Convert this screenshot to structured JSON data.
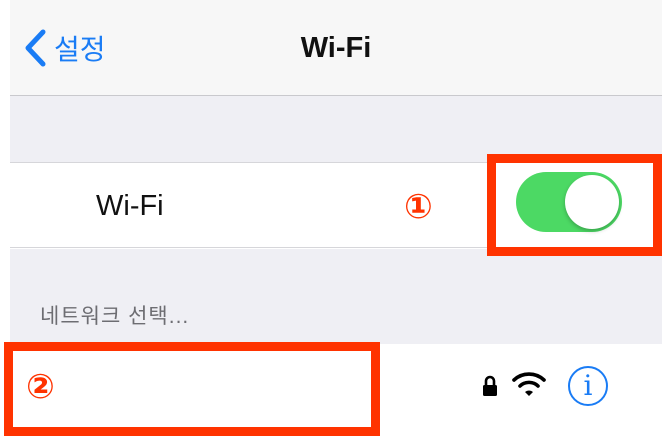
{
  "navbar": {
    "back_label": "설정",
    "title": "Wi-Fi"
  },
  "wifi_row": {
    "label": "Wi-Fi",
    "toggle_on": true
  },
  "networks": {
    "section_header": "네트워크 선택..."
  },
  "annotations": {
    "marker_1": "①",
    "marker_2": "②",
    "color": "#ff3300"
  },
  "icons": {
    "back": "chevron-left-icon",
    "lock": "lock-icon",
    "wifi": "wifi-signal-icon",
    "info": "info-icon",
    "info_glyph": "i"
  },
  "colors": {
    "accent": "#1a7cf5",
    "toggle_on": "#4cd964",
    "group_background": "#efeff4"
  }
}
